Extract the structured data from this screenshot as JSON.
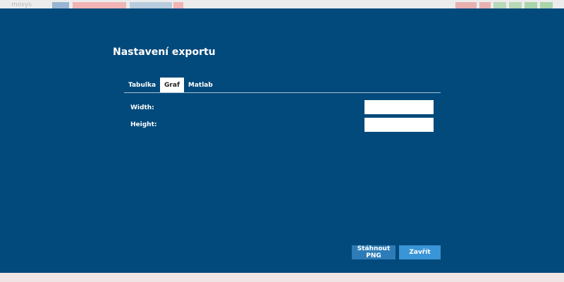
{
  "background": {
    "logo": "mosys",
    "colors": [
      "#9ab5d2",
      "#f2b4b4",
      "#b8ccdd",
      "#f2b4b4",
      "#e8b0b0",
      "#e8b0b0",
      "#b7d9b7",
      "#b7d9b7",
      "#aad4aa",
      "#aad4aa"
    ]
  },
  "dialog": {
    "title": "Nastavení exportu",
    "tabs": [
      {
        "label": "Tabulka",
        "active": false
      },
      {
        "label": "Graf",
        "active": true
      },
      {
        "label": "Matlab",
        "active": false
      }
    ],
    "fields": {
      "width": {
        "label": "Width:",
        "value": ""
      },
      "height": {
        "label": "Height:",
        "value": ""
      }
    },
    "buttons": {
      "download": "Stáhnout PNG",
      "close": "Zavřít"
    }
  },
  "colors": {
    "modal_bg": "#024a7b",
    "download_btn": "#2d7cb8",
    "close_btn": "#3a95d6",
    "active_tab_bg": "#ffffff"
  }
}
